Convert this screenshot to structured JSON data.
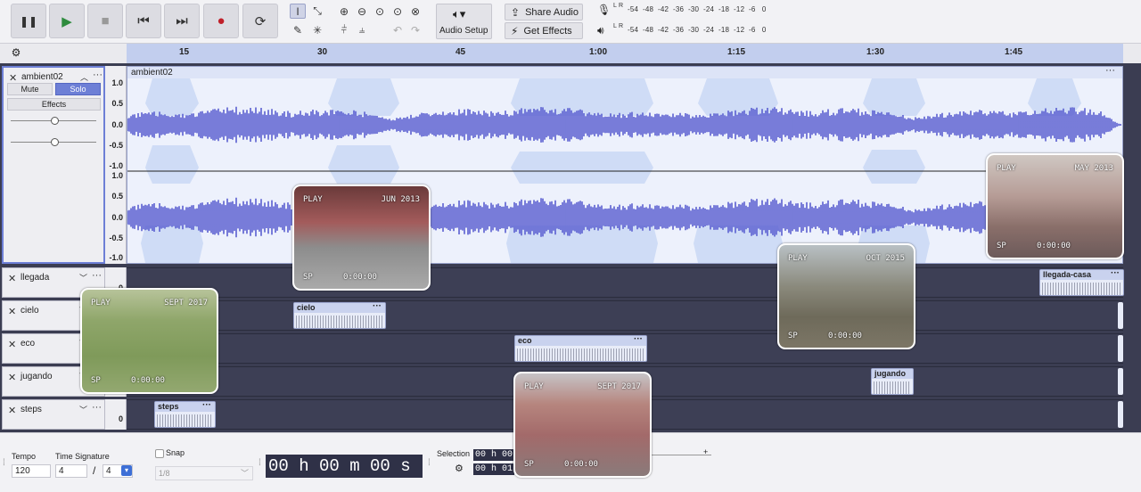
{
  "toolbar": {
    "transport": [
      {
        "name": "pause-button",
        "glyph": "❚❚"
      },
      {
        "name": "play-button",
        "glyph": "▶"
      },
      {
        "name": "stop-button",
        "glyph": "■"
      },
      {
        "name": "skip-start-button",
        "glyph": "⏮"
      },
      {
        "name": "skip-end-button",
        "glyph": "⏭"
      },
      {
        "name": "record-button",
        "glyph": "●"
      },
      {
        "name": "loop-button",
        "glyph": "⟳"
      }
    ],
    "audio_setup_label": "Audio Setup",
    "share_audio_label": "Share Audio",
    "get_effects_label": "Get Effects",
    "meter_ticks_rec": "-54  -48  -42  -36  -30  -24  -18  -12  -6   0",
    "meter_ticks_play": "-54  -48  -42  -36  -30  -24  -18  -12  -6   0",
    "meter_lr": "L R"
  },
  "ruler": {
    "labels": [
      "15",
      "30",
      "45",
      "1:00",
      "1:15",
      "1:30",
      "1:45"
    ]
  },
  "tracks": {
    "main": {
      "name": "ambient02",
      "mute_label": "Mute",
      "solo_label": "Solo",
      "effects_label": "Effects",
      "clip_name": "ambient02",
      "scale_top": [
        "1.0",
        "0.5",
        "0.0",
        "-0.5",
        "-1.0"
      ],
      "scale_bottom": [
        "1.0",
        "0.5",
        "0.0",
        "-0.5",
        "-1.0"
      ]
    },
    "small": [
      {
        "name": "llegada"
      },
      {
        "name": "cielo"
      },
      {
        "name": "eco"
      },
      {
        "name": "jugando"
      },
      {
        "name": "steps"
      }
    ],
    "steps_scale": "0",
    "llegada_scale": "0"
  },
  "clips": {
    "cielo": "cielo",
    "eco": "eco",
    "jugando": "jugando",
    "steps": "steps",
    "llegada": "llegada-casa"
  },
  "photos": [
    {
      "play": "PLAY",
      "date": "SEPT 2017",
      "sp": "SP",
      "tc": "0:00:00"
    },
    {
      "play": "PLAY",
      "date": "JUN 2013",
      "sp": "SP",
      "tc": "0:00:00"
    },
    {
      "play": "PLAY",
      "date": "OCT 2015",
      "sp": "SP",
      "tc": "0:00:00"
    },
    {
      "play": "PLAY",
      "date": "MAY 2013",
      "sp": "SP",
      "tc": "0:00:00"
    },
    {
      "play": "PLAY",
      "date": "SEPT 2017",
      "sp": "SP",
      "tc": "0:00:00"
    }
  ],
  "bottom": {
    "tempo_label": "Tempo",
    "tempo_value": "120",
    "time_sig_label": "Time Signature",
    "time_sig_num": "4",
    "time_sig_sep": "/",
    "time_sig_den": "4",
    "snap_label": "Snap",
    "snap_value": "1/8",
    "time_display": "00 h 00 m 00 s",
    "selection_label": "Selection",
    "selection_start": "00 h 00",
    "selection_end": "00 h 01"
  },
  "colors": {
    "waveform": "#5a5fd0",
    "track_bg": "#3b3d52",
    "selection_band": "#c2ceee"
  }
}
